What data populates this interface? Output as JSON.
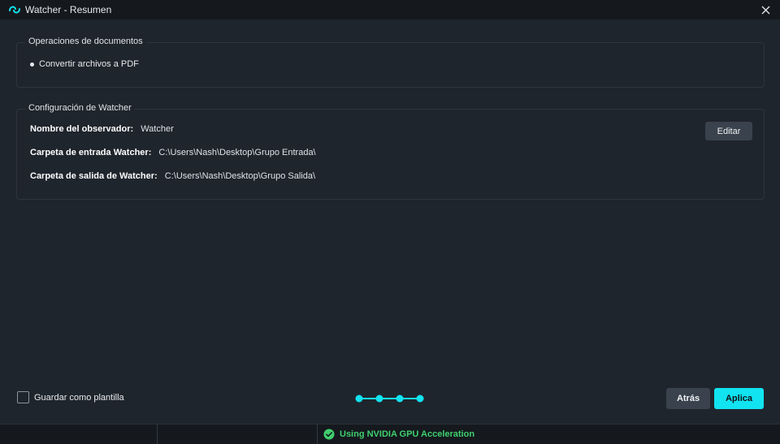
{
  "window": {
    "title": "Watcher - Resumen"
  },
  "operations": {
    "legend": "Operaciones de documentos",
    "items": [
      "Convertir archivos a PDF"
    ]
  },
  "config": {
    "legend": "Configuración de Watcher",
    "rows": [
      {
        "label": "Nombre del observador:",
        "value": "Watcher"
      },
      {
        "label": "Carpeta de entrada Watcher:",
        "value": "C:\\Users\\Nash\\Desktop\\Grupo Entrada\\"
      },
      {
        "label": "Carpeta de salida de Watcher:",
        "value": "C:\\Users\\Nash\\Desktop\\Grupo Salida\\"
      }
    ],
    "edit_label": "Editar"
  },
  "footer": {
    "save_template_label": "Guardar como plantilla",
    "back_label": "Atrás",
    "apply_label": "Aplica",
    "steps_total": 4
  },
  "status": {
    "gpu_text": "Using NVIDIA GPU Acceleration"
  },
  "colors": {
    "accent": "#12e3f0",
    "background": "#1f252d",
    "status_ok": "#3fcf6e"
  },
  "icons": {
    "app": "watcher-logo-icon",
    "close": "close-icon",
    "gpu": "check-circle-icon"
  }
}
